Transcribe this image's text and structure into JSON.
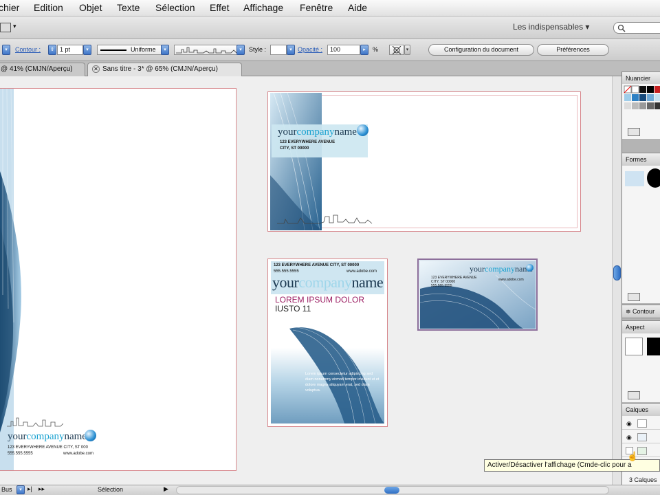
{
  "menu": [
    "chier",
    "Edition",
    "Objet",
    "Texte",
    "Sélection",
    "Effet",
    "Affichage",
    "Fenêtre",
    "Aide"
  ],
  "appbar": {
    "workspace": "Les indispensables ▾"
  },
  "control": {
    "contour_label": "Contour :",
    "stroke_weight": "1 pt",
    "stroke_style": "Uniforme",
    "style_label": "Style :",
    "opacity_label": "Opacité :",
    "opacity_value": "100",
    "percent": "%",
    "doc_setup": "Configuration du document",
    "preferences": "Préférences"
  },
  "tabs": [
    {
      "label": "@ 41% (CMJN/Aperçu)"
    },
    {
      "label": "Sans titre - 3* @ 65% (CMJN/Aperçu)"
    }
  ],
  "letterhead": {
    "brand_a": "your",
    "brand_b": "company",
    "brand_c": "name",
    "address": "123 EVERYWHERE AVENUE CITY, ST 000",
    "phone": "555.555.5555",
    "web": "www.adobe.com"
  },
  "envelope": {
    "brand_a": "your",
    "brand_b": "company",
    "brand_c": "name",
    "addr1": "123 EVERYWHERE AVENUE",
    "addr2": "CITY, ST 00000"
  },
  "flyer": {
    "top_line": "123 EVERYWHERE AVENUE CITY, ST 00000",
    "phone": "555.555.5555",
    "web": "www.adobe.com",
    "brand_a": "your",
    "brand_b": "company",
    "brand_c": "name",
    "headline1": "LOREM IPSUM DOLOR",
    "headline2": "IUSTO 11",
    "body": "Lorem ipsum consectetur adipiscing sed diam nonummy eirmod tempor invidunt ut et dolore magna aliquyam erat, sed diam voluptua."
  },
  "card": {
    "brand_a": "your",
    "brand_b": "company",
    "brand_c": "name",
    "line1": "123 EVERYWHERE AVENUE",
    "line2": "CITY, ST 00000",
    "line3": "555.555.5555",
    "web": "www.adobe.com"
  },
  "panels": {
    "nuancier": "Nuancier",
    "formes": "Formes",
    "contour": "≑ Contour",
    "aspect": "Aspect",
    "calques": "Calques",
    "calques_count": "3 Calques"
  },
  "tooltip": "Activer/Désactiver l'affichage (Cmde-clic pour a",
  "status": {
    "selection": "Sélection",
    "zoom_fragment": "Bus"
  },
  "colors": {
    "accent": "#1aa2d0",
    "dark": "#1b3850",
    "magenta": "#9c1e63",
    "bleed": "#d6868b"
  }
}
